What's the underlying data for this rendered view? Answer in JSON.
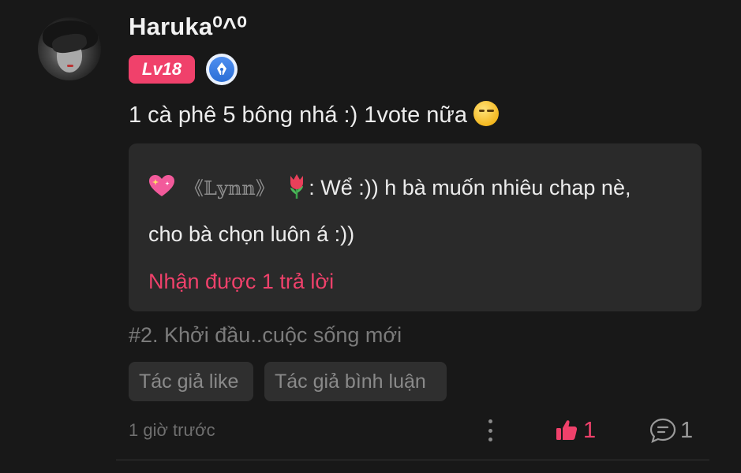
{
  "user": {
    "name": "Haruka⁰^⁰",
    "level": "Lv18"
  },
  "comment": {
    "text": "1 cà phê 5 bông nhá :) 1vote nữa"
  },
  "reply": {
    "author": "《𝕃𝕪𝕟𝕟》",
    "line1": ": Wể :)) h bà muốn nhiêu chap nè,",
    "line2": "cho bà chọn luôn á :))",
    "replies_link": "Nhận được 1 trả lời"
  },
  "chapter": "#2. Khởi đầu..cuộc sống mới",
  "tags": [
    "Tác giả like",
    "Tác giả bình luận"
  ],
  "footer": {
    "timestamp": "1 giờ trước",
    "like_count": "1",
    "reply_count": "1"
  },
  "colors": {
    "accent": "#f0416b",
    "background": "#181818",
    "card": "#2a2a2a"
  }
}
